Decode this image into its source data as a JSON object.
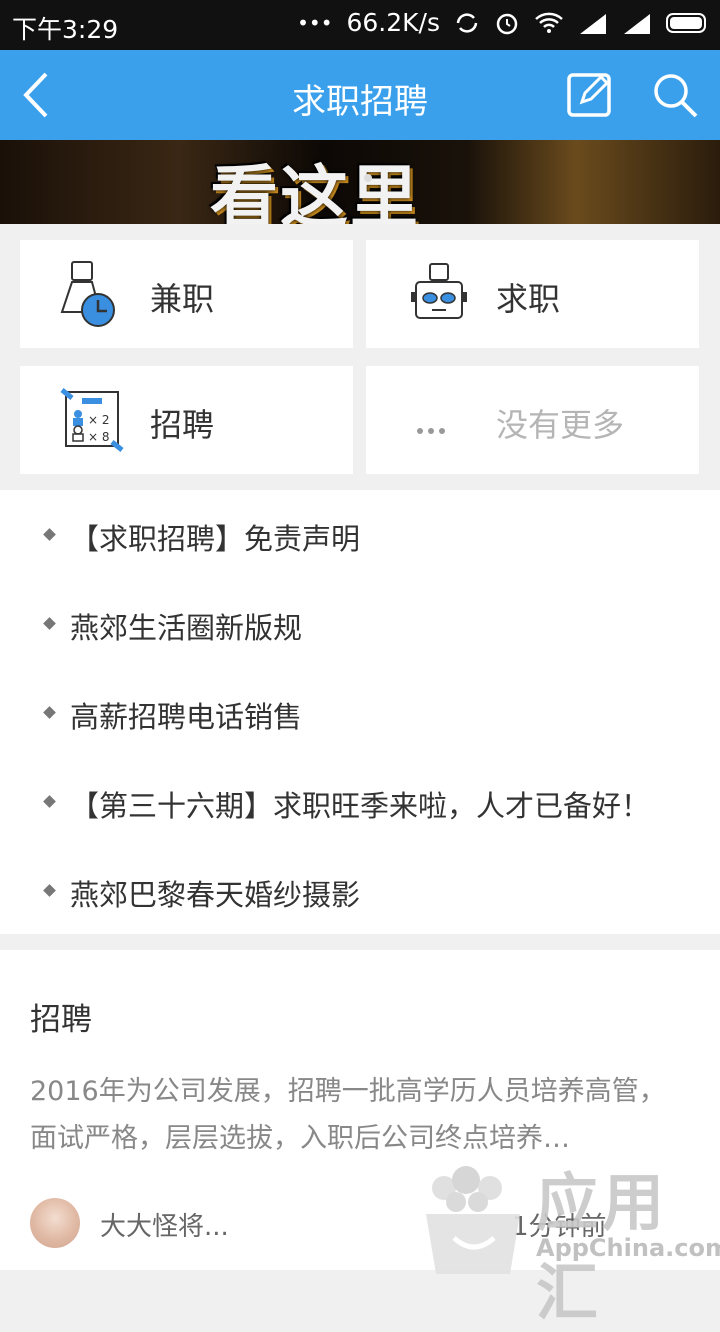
{
  "statusbar": {
    "time": "下午3:29",
    "dots": "•••",
    "speed": "66.2K/s"
  },
  "appbar": {
    "title": "求职招聘"
  },
  "banner": {
    "text": "看这里"
  },
  "grid": [
    {
      "label": "兼职",
      "icon": "part-time-clock-icon"
    },
    {
      "label": "求职",
      "icon": "job-seeker-icon"
    },
    {
      "label": "招聘",
      "icon": "recruit-board-icon"
    },
    {
      "label": "没有更多",
      "icon": "more-dots-icon"
    }
  ],
  "list": [
    "【求职招聘】免责声明",
    "燕郊生活圈新版规",
    "高薪招聘电话销售",
    "【第三十六期】求职旺季来啦，人才已备好！",
    "燕郊巴黎春天婚纱摄影"
  ],
  "post": {
    "title": "招聘",
    "body": "2016年为公司发展，招聘一批高学历人员培养高管，面试严格，层层选拔，入职后公司终点培养…",
    "author": "大大怪将...",
    "time": "1分钟前"
  },
  "watermark": {
    "title": "应用汇",
    "sub": "AppChina.com"
  },
  "colors": {
    "appbar": "#3aa0ec",
    "accent": "#2f8fe0"
  }
}
